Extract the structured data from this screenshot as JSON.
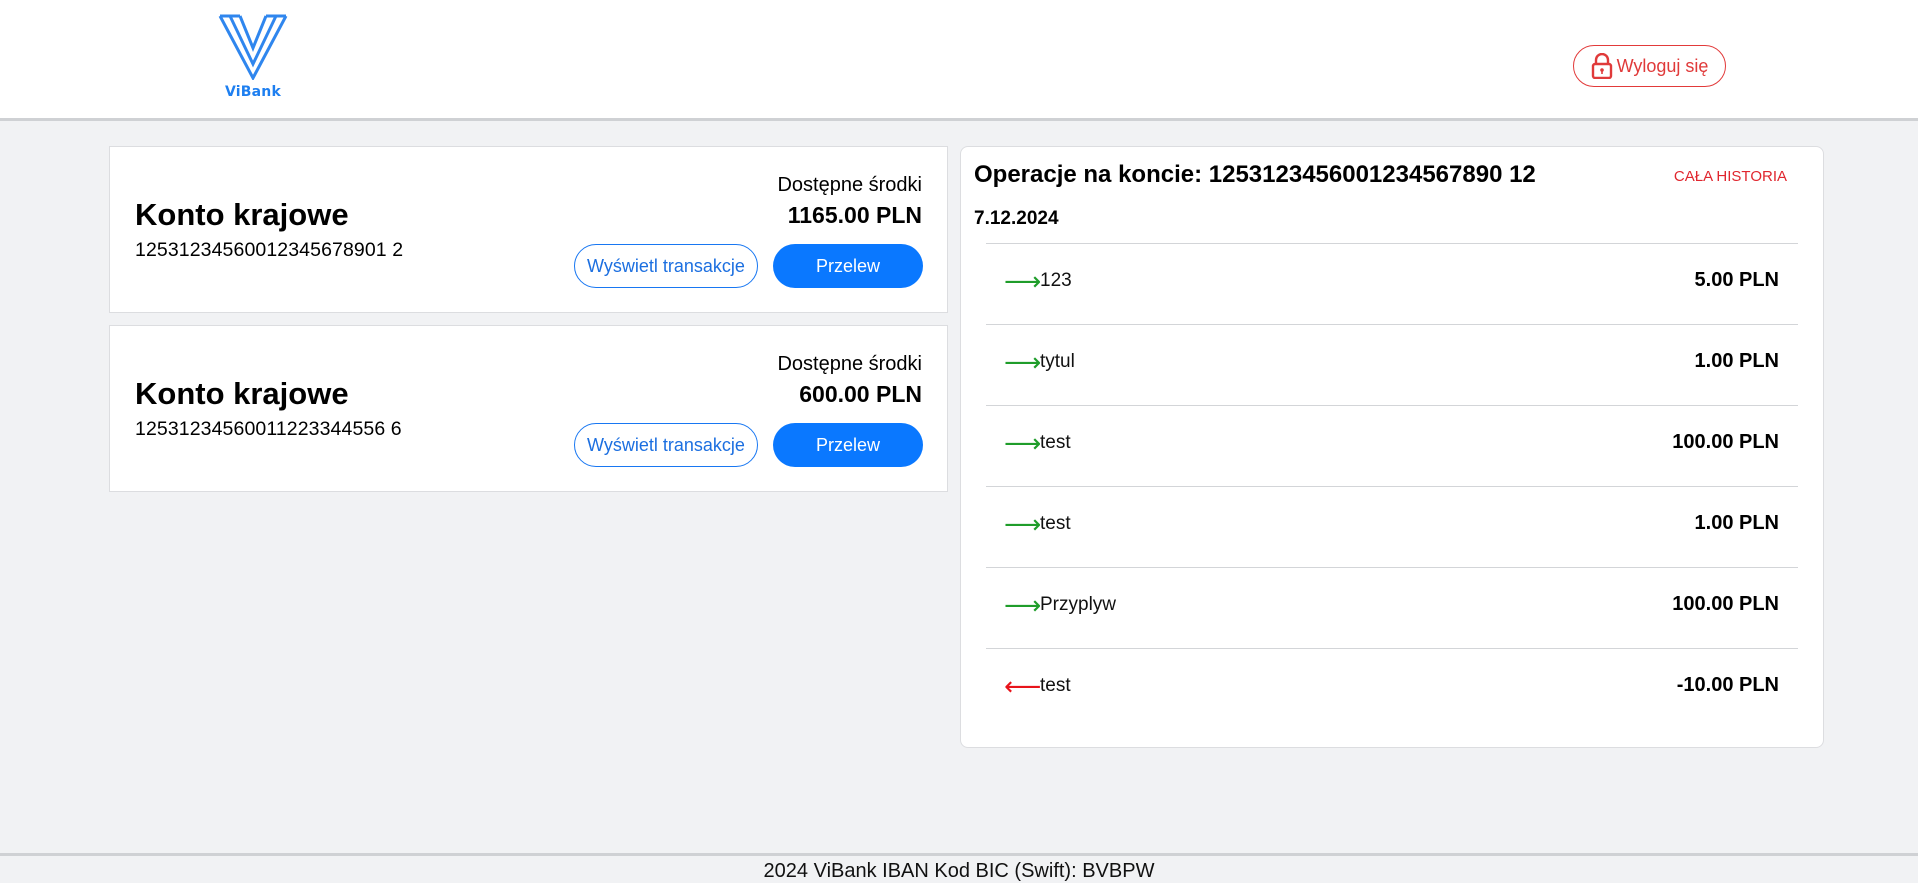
{
  "header": {
    "logo_text": "ViBank",
    "logout_label": "Wyloguj się",
    "logout_icon": "lock-icon"
  },
  "accounts": [
    {
      "title": "Konto krajowe",
      "number": "12531234560012345678901 2",
      "available_label": "Dostępne środki",
      "balance": "1165.00 PLN",
      "view_transactions_label": "Wyświetl transakcje",
      "transfer_label": "Przelew"
    },
    {
      "title": "Konto krajowe",
      "number": "12531234560011223344556 6",
      "available_label": "Dostępne środki",
      "balance": "600.00 PLN",
      "view_transactions_label": "Wyświetl transakcje",
      "transfer_label": "Przelew"
    }
  ],
  "operations": {
    "title": "Operacje na koncie: 1253123456001234567890 12",
    "all_history_label": "CAŁA HISTORIA",
    "date": "7.12.2024",
    "transactions": [
      {
        "direction": "in",
        "arrow": "⟶",
        "title": "123",
        "amount": "5.00 PLN"
      },
      {
        "direction": "in",
        "arrow": "⟶",
        "title": "tytul",
        "amount": "1.00 PLN"
      },
      {
        "direction": "in",
        "arrow": "⟶",
        "title": "test",
        "amount": "100.00 PLN"
      },
      {
        "direction": "in",
        "arrow": "⟶",
        "title": "test",
        "amount": "1.00 PLN"
      },
      {
        "direction": "in",
        "arrow": "⟶",
        "title": "Przyplyw",
        "amount": "100.00 PLN"
      },
      {
        "direction": "out",
        "arrow": "⟵",
        "title": "test",
        "amount": "-10.00 PLN"
      }
    ]
  },
  "footer": {
    "text": "2024 ViBank IBAN Kod BIC (Swift): BVBPW"
  },
  "colors": {
    "primary": "#0a78ff",
    "danger": "#e03a3a",
    "incoming": "#1f9d2a",
    "outgoing": "#e8141b",
    "background": "#f1f2f4"
  }
}
